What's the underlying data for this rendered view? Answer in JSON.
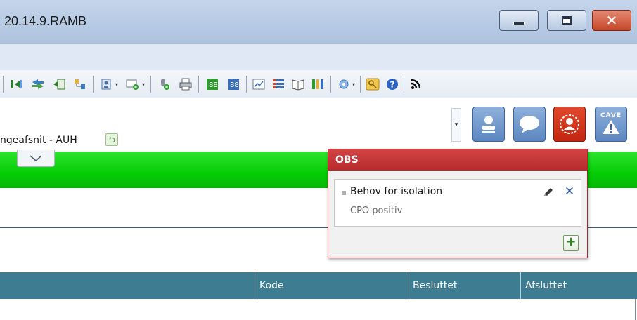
{
  "window": {
    "title": "20.14.9.RAMB",
    "controls": {
      "minimize_icon": "minimize-icon",
      "maximize_icon": "maximize-icon",
      "close_icon": "close-icon"
    }
  },
  "toolbar": {
    "icons": [
      "nav-first-icon",
      "transfer-icon",
      "export-icon",
      "tree-icon",
      "contacts-dropdown-icon",
      "form-dropdown-icon",
      "microphone-icon",
      "print-icon",
      "excel-green-icon",
      "excel-blue-icon",
      "chart-icon",
      "list-icon",
      "book-icon",
      "columns-icon",
      "settings-dropdown-icon",
      "key-icon",
      "help-icon",
      "rss-icon"
    ]
  },
  "context": {
    "location_label": "ngeafsnit - AUH",
    "refresh_icon": "refresh-icon",
    "buttons": [
      {
        "name": "patient-button",
        "icon": "person-icon"
      },
      {
        "name": "message-button",
        "icon": "chat-icon"
      },
      {
        "name": "obs-button",
        "icon": "obs-person-icon"
      },
      {
        "name": "cave-button",
        "label": "CAVE",
        "icon": "warning-icon"
      }
    ]
  },
  "green_bar": {
    "collapse_icon": "chevron-down-icon"
  },
  "table": {
    "headers": [
      "",
      "Kode",
      "Besluttet",
      "Afsluttet"
    ]
  },
  "obs_popup": {
    "title": "OBS",
    "items": [
      {
        "title": "Behov for isolation",
        "detail": "CPO positiv"
      }
    ],
    "add_label": "+"
  },
  "colors": {
    "green_bar": "#05cc05",
    "table_header": "#3e7c92",
    "obs_header": "#c43536",
    "obs_button": "#d4361b"
  }
}
